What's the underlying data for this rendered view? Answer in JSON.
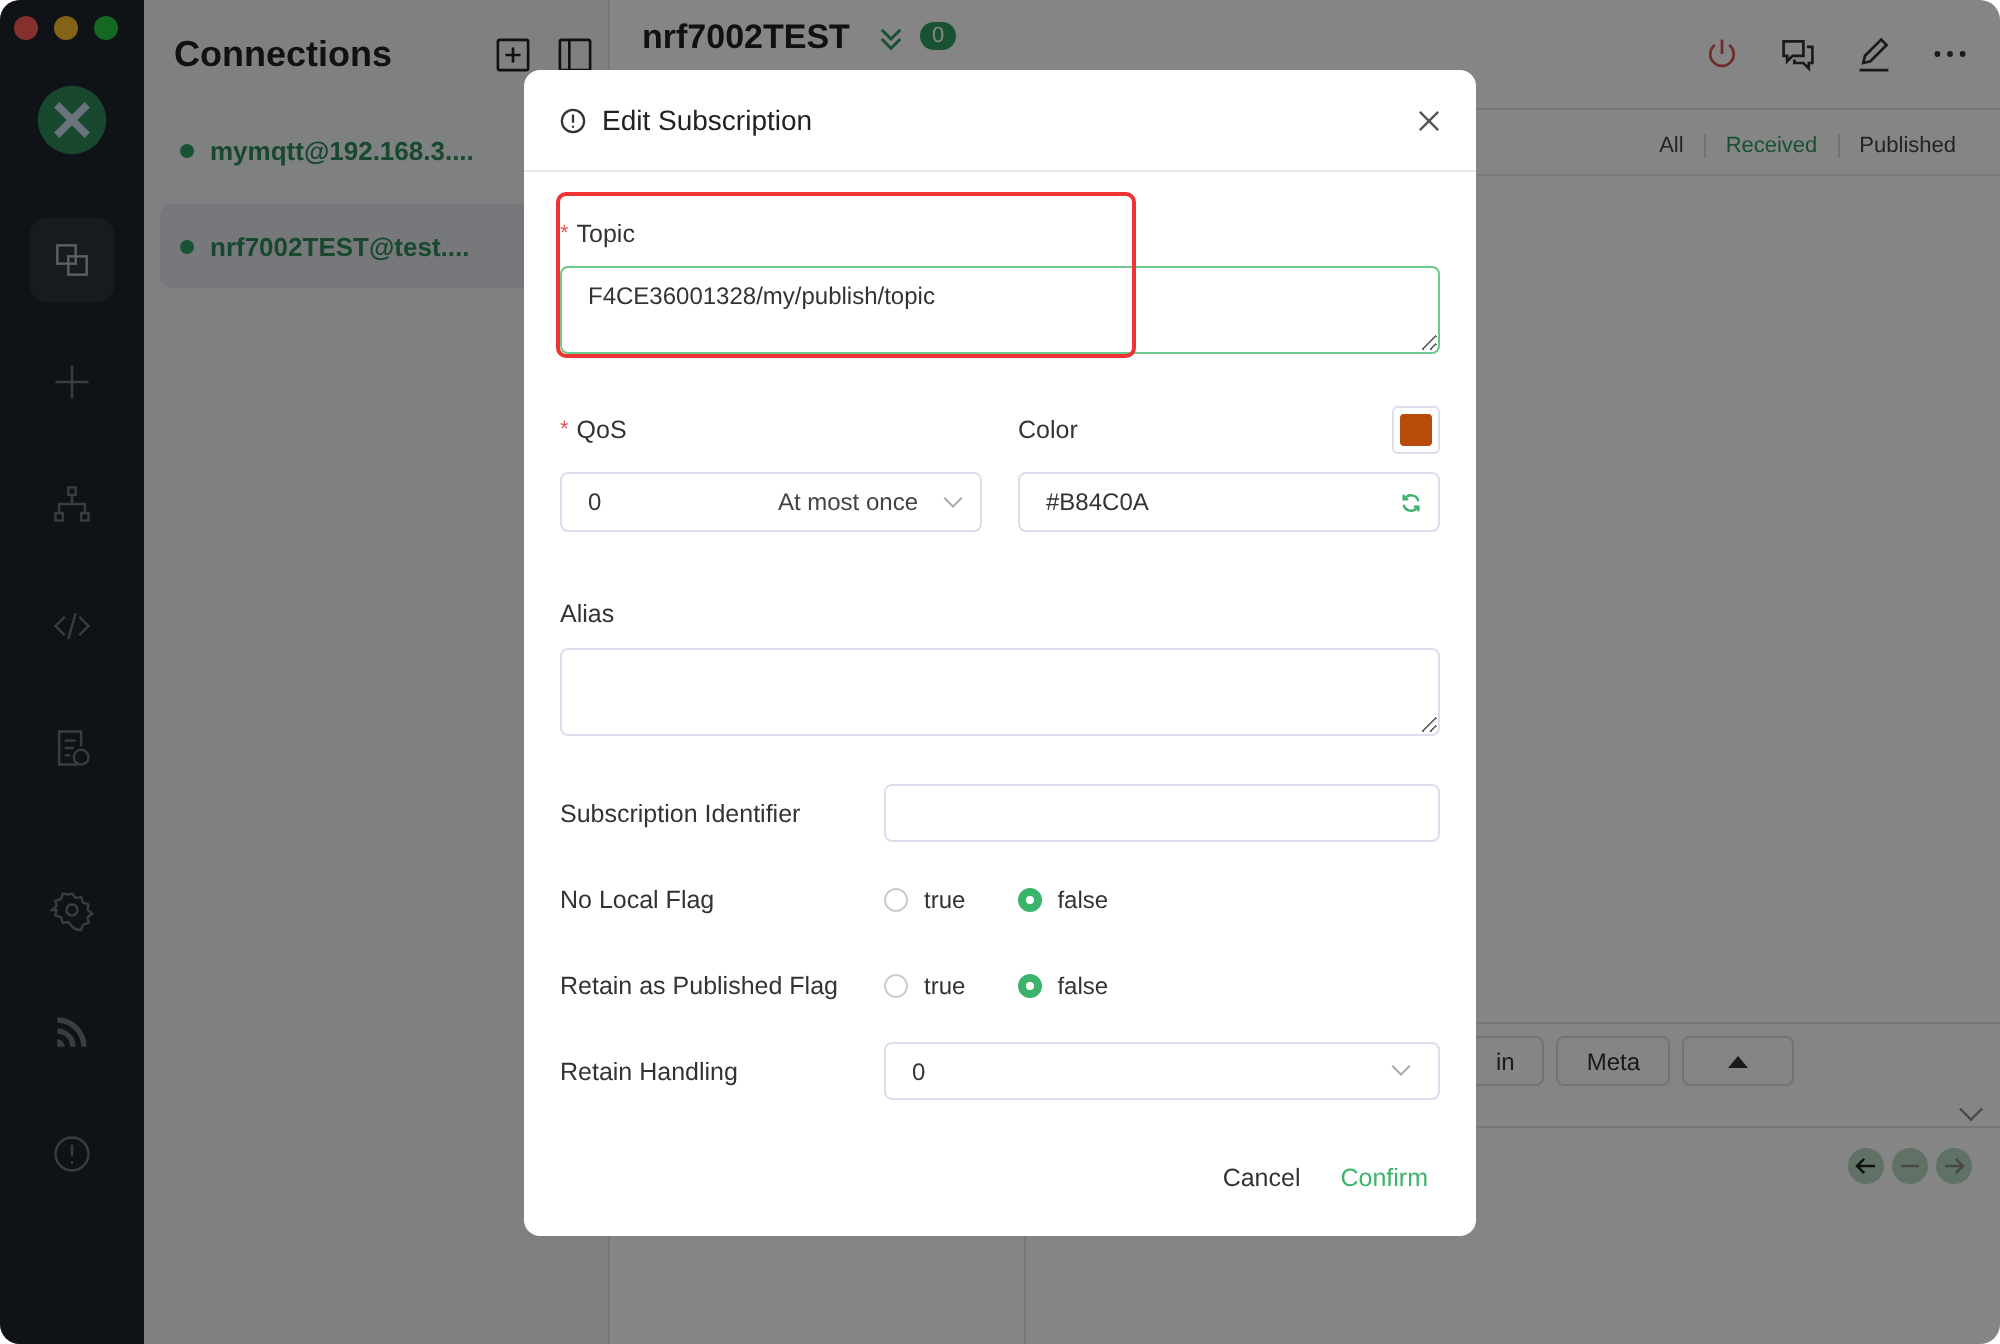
{
  "sidebar": {
    "items": [
      {
        "kind": "connections",
        "selected": true
      },
      {
        "kind": "new",
        "selected": false
      },
      {
        "kind": "topology",
        "selected": false
      },
      {
        "kind": "script",
        "selected": false
      },
      {
        "kind": "log",
        "selected": false
      },
      {
        "kind": "settings",
        "selected": false
      },
      {
        "kind": "feed",
        "selected": false
      },
      {
        "kind": "about",
        "selected": false
      }
    ]
  },
  "connections": {
    "title": "Connections",
    "items": [
      {
        "label": "mymqtt@192.168.3....",
        "selected": false,
        "connected": true
      },
      {
        "label": "nrf7002TEST@test....",
        "selected": true,
        "connected": true
      }
    ]
  },
  "main": {
    "title": "nrf7002TEST",
    "badge": "0",
    "filters": [
      {
        "label": "All",
        "selected": false
      },
      {
        "label": "Received",
        "selected": true
      },
      {
        "label": "Published",
        "selected": false
      }
    ],
    "buttons": [
      "in",
      "Meta"
    ]
  },
  "dialog": {
    "title": "Edit Subscription",
    "topic": {
      "required_mark": "*",
      "label": "Topic",
      "value": "F4CE36001328/my/publish/topic",
      "highlighted": true
    },
    "qos": {
      "required_mark": "*",
      "label": "QoS",
      "value": "0",
      "option_label": "At most once"
    },
    "color": {
      "label": "Color",
      "value": "#B84C0A"
    },
    "alias": {
      "label": "Alias"
    },
    "rows": [
      {
        "kind": "input",
        "label": "Subscription Identifier"
      },
      {
        "kind": "radio",
        "label": "No Local Flag",
        "options": [
          {
            "label": "true",
            "selected": false
          },
          {
            "label": "false",
            "selected": true
          }
        ]
      },
      {
        "kind": "radio",
        "label": "Retain as Published Flag",
        "options": [
          {
            "label": "true",
            "selected": false
          },
          {
            "label": "false",
            "selected": true
          }
        ]
      },
      {
        "kind": "select",
        "label": "Retain Handling",
        "value": "0"
      }
    ],
    "buttons": {
      "cancel": "Cancel",
      "confirm": "Confirm"
    }
  }
}
